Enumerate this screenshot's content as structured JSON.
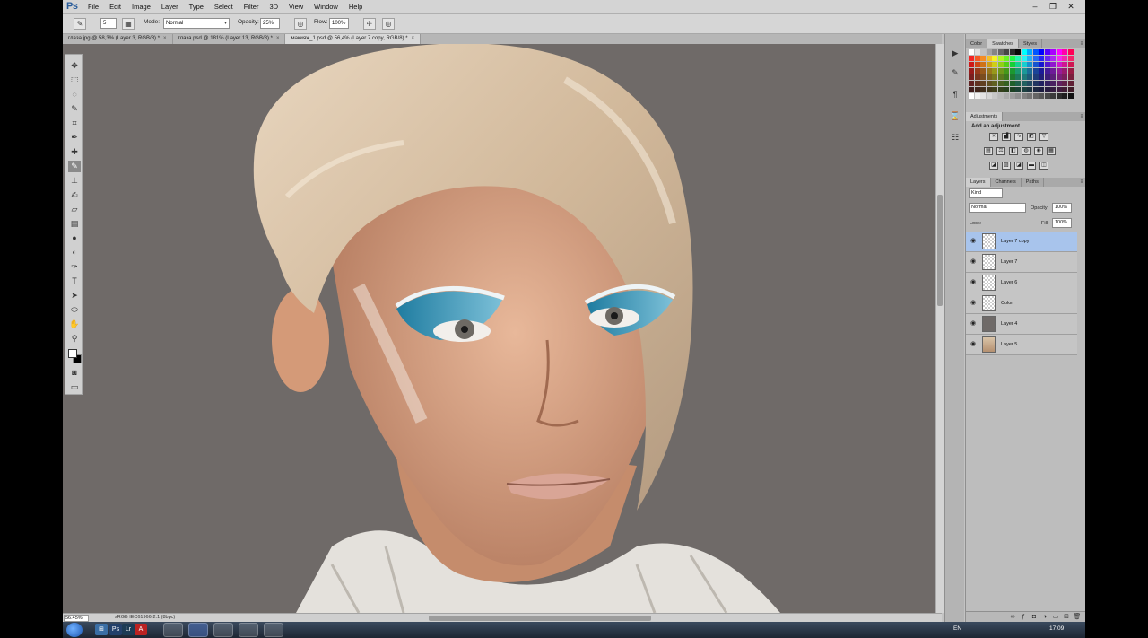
{
  "app": {
    "logo": "Ps"
  },
  "menu": [
    "File",
    "Edit",
    "Image",
    "Layer",
    "Type",
    "Select",
    "Filter",
    "3D",
    "View",
    "Window",
    "Help"
  ],
  "window_controls": {
    "minimize": "–",
    "restore": "❐",
    "close": "✕"
  },
  "options": {
    "brush_size": "5",
    "mode_label": "Mode:",
    "mode_value": "Normal",
    "opacity_label": "Opacity:",
    "opacity_value": "25%",
    "flow_label": "Flow:",
    "flow_value": "100%"
  },
  "doc_tabs": [
    {
      "label": "глаза.jpg @ 58,3% (Layer 3, RGB/8) *",
      "active": false
    },
    {
      "label": "глаза.psd @ 181% (Layer 13, RGB/8) *",
      "active": false
    },
    {
      "label": "макияж_1.psd @ 56,4% (Layer 7 copy, RGB/8) *",
      "active": true
    }
  ],
  "status": {
    "zoom": "56.45%",
    "doc_info": "sRGB IEC61966-2.1 (8bpc)"
  },
  "panels": {
    "color_tabs": [
      "Color",
      "Swatches",
      "Styles"
    ],
    "color_active": "Swatches",
    "adjustments_tab": "Adjustments",
    "adjustments_title": "Add an adjustment",
    "layers_tabs": [
      "Layers",
      "Channels",
      "Paths"
    ],
    "layers_active": "Layers",
    "kind_value": "Kind",
    "blend_mode": "Normal",
    "opacity_label": "Opacity:",
    "opacity_value": "100%",
    "lock_label": "Lock:",
    "fill_label": "Fill:",
    "fill_value": "100%"
  },
  "layers": [
    {
      "name": "Layer 7 copy",
      "thumb": "check",
      "selected": true
    },
    {
      "name": "Layer 7",
      "thumb": "check",
      "selected": false
    },
    {
      "name": "Layer 6",
      "thumb": "check",
      "selected": false
    },
    {
      "name": "Color",
      "thumb": "check",
      "selected": false
    },
    {
      "name": "Layer 4",
      "thumb": "gray",
      "selected": false
    },
    {
      "name": "Layer 5",
      "thumb": "photo",
      "selected": false
    }
  ],
  "taskbar": {
    "lang": "EN",
    "time": "17:09"
  },
  "colors": {
    "selection": "#a8c4ec",
    "canvas_bg": "#6f6a68",
    "chrome": "#c3c3c3"
  }
}
